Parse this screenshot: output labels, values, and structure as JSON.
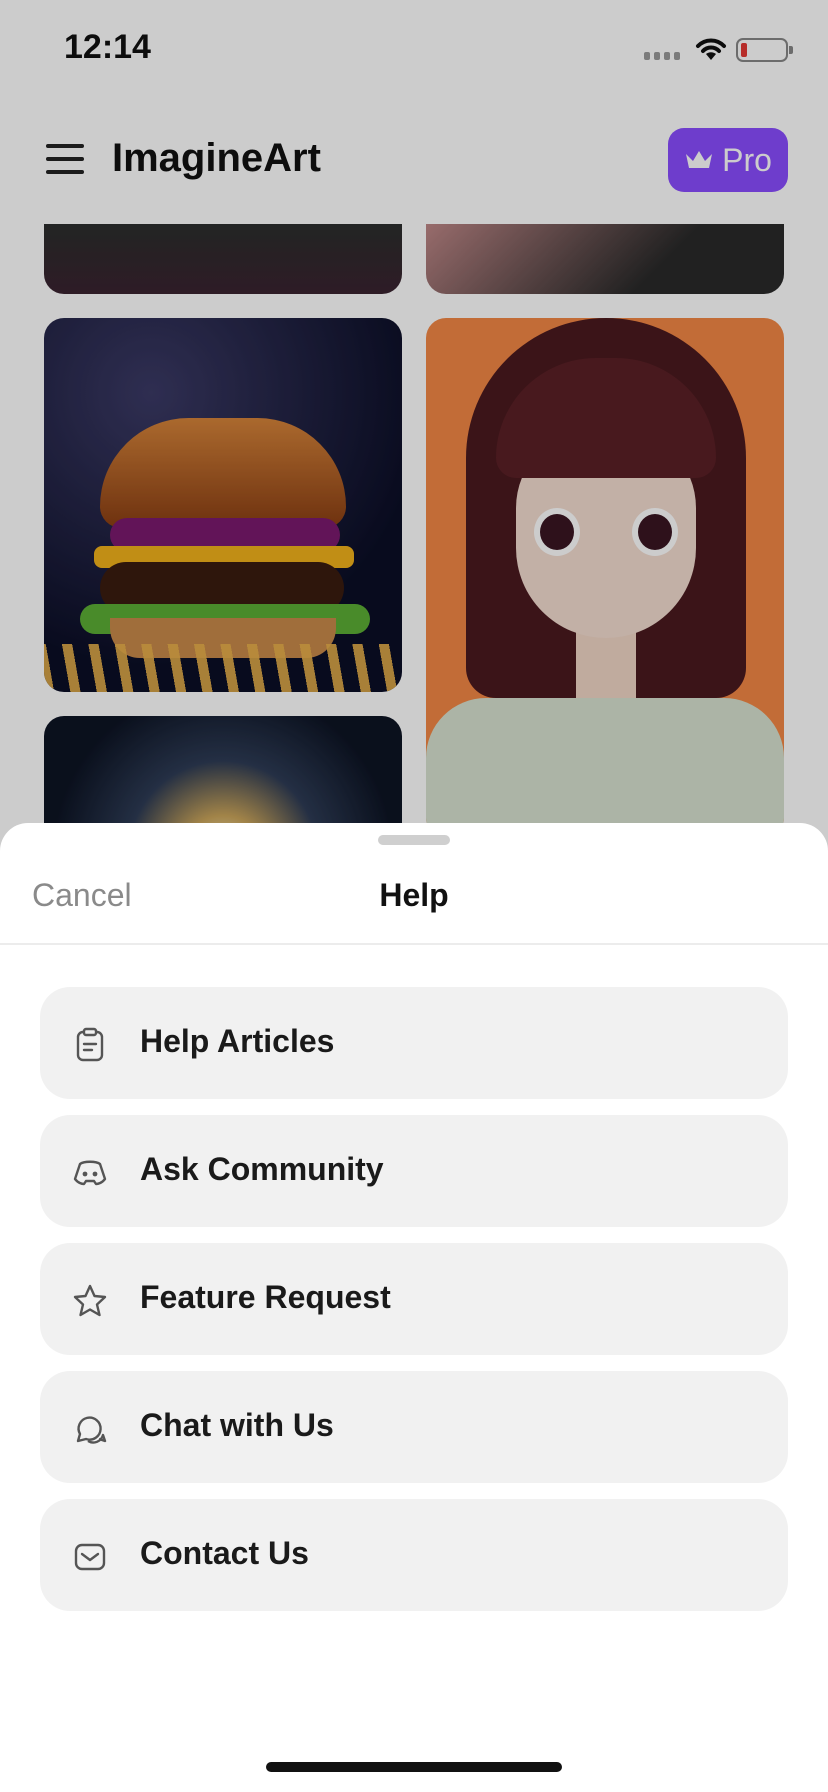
{
  "status_bar": {
    "time": "12:14"
  },
  "header": {
    "app_title": "ImagineArt",
    "pro_label": "Pro"
  },
  "sheet": {
    "cancel_label": "Cancel",
    "title": "Help",
    "options": [
      {
        "label": "Help Articles",
        "icon": "clipboard-icon"
      },
      {
        "label": "Ask Community",
        "icon": "discord-icon"
      },
      {
        "label": "Feature Request",
        "icon": "star-icon"
      },
      {
        "label": "Chat with Us",
        "icon": "chat-bubbles-icon"
      },
      {
        "label": "Contact Us",
        "icon": "mail-icon"
      }
    ]
  },
  "colors": {
    "pro_accent": "#8a4dff",
    "option_background": "#f1f1f1",
    "battery_low": "#e53935"
  }
}
